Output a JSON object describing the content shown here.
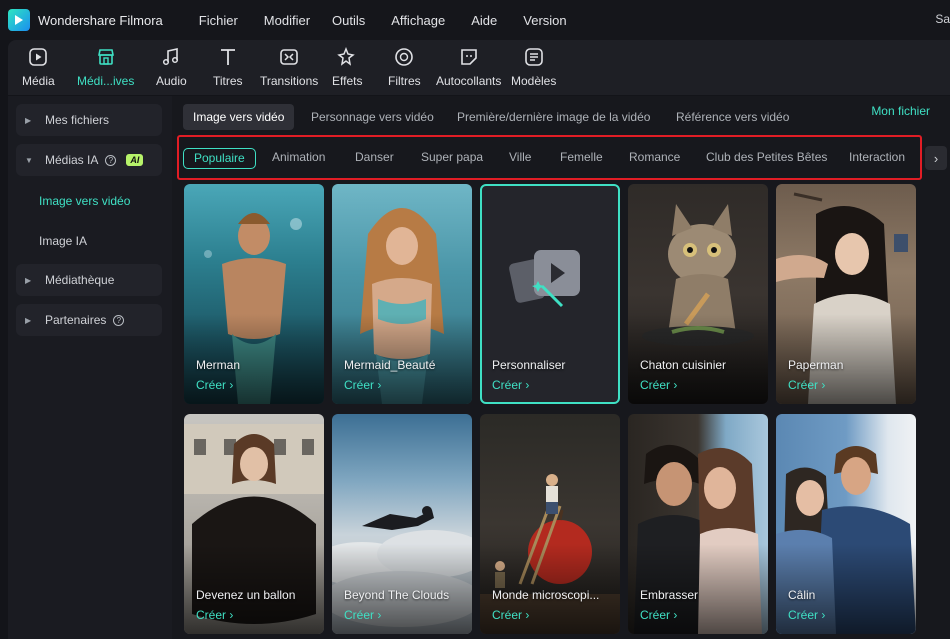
{
  "app": {
    "name": "Wondershare Filmora",
    "right_edge_text": "Sa"
  },
  "menu": [
    "Fichier",
    "Modifier",
    "Outils",
    "Affichage",
    "Aide",
    "Version"
  ],
  "toolbar": [
    {
      "label": "Média",
      "icon": "media-icon"
    },
    {
      "label": "Médi...ives",
      "icon": "stock-media-icon",
      "active": true
    },
    {
      "label": "Audio",
      "icon": "music-note-icon"
    },
    {
      "label": "Titres",
      "icon": "text-t-icon"
    },
    {
      "label": "Transitions",
      "icon": "transition-icon"
    },
    {
      "label": "Effets",
      "icon": "sparkle-star-icon"
    },
    {
      "label": "Filtres",
      "icon": "filter-icon"
    },
    {
      "label": "Autocollants",
      "icon": "sticker-icon"
    },
    {
      "label": "Modèles",
      "icon": "template-icon"
    }
  ],
  "sidebar": {
    "my_files": "Mes fichiers",
    "ai_media": "Médias IA",
    "ai_badge": "AI",
    "image_to_video": "Image vers vidéo",
    "ai_image": "Image IA",
    "library": "Médiathèque",
    "partners": "Partenaires"
  },
  "top_tabs": [
    "Image vers vidéo",
    "Personnage vers vidéo",
    "Première/dernière image de la vidéo",
    "Référence vers vidéo"
  ],
  "my_file_link": "Mon fichier",
  "categories": [
    "Populaire",
    "Animation",
    "Danser",
    "Super papa",
    "Ville",
    "Femelle",
    "Romance",
    "Club des Petites Bêtes",
    "Interaction"
  ],
  "cards": [
    {
      "title": "Merman",
      "action": "Créer ›"
    },
    {
      "title": "Mermaid_Beauté",
      "action": "Créer ›"
    },
    {
      "title": "Personnaliser",
      "action": "Créer ›"
    },
    {
      "title": "Chaton cuisinier",
      "action": "Créer ›"
    },
    {
      "title": "Paperman",
      "action": "Créer ›"
    },
    {
      "title": "Devenez un ballon",
      "action": "Créer ›"
    },
    {
      "title": "Beyond The Clouds",
      "action": "Créer ›"
    },
    {
      "title": "Monde microscopi...",
      "action": "Créer ›"
    },
    {
      "title": "Embrasser",
      "action": "Créer ›"
    },
    {
      "title": "Câlin",
      "action": "Créer ›"
    }
  ],
  "colors": {
    "accent": "#3fe0c4",
    "highlight_border": "#e11d25",
    "ai_badge": "#b7f36a"
  }
}
